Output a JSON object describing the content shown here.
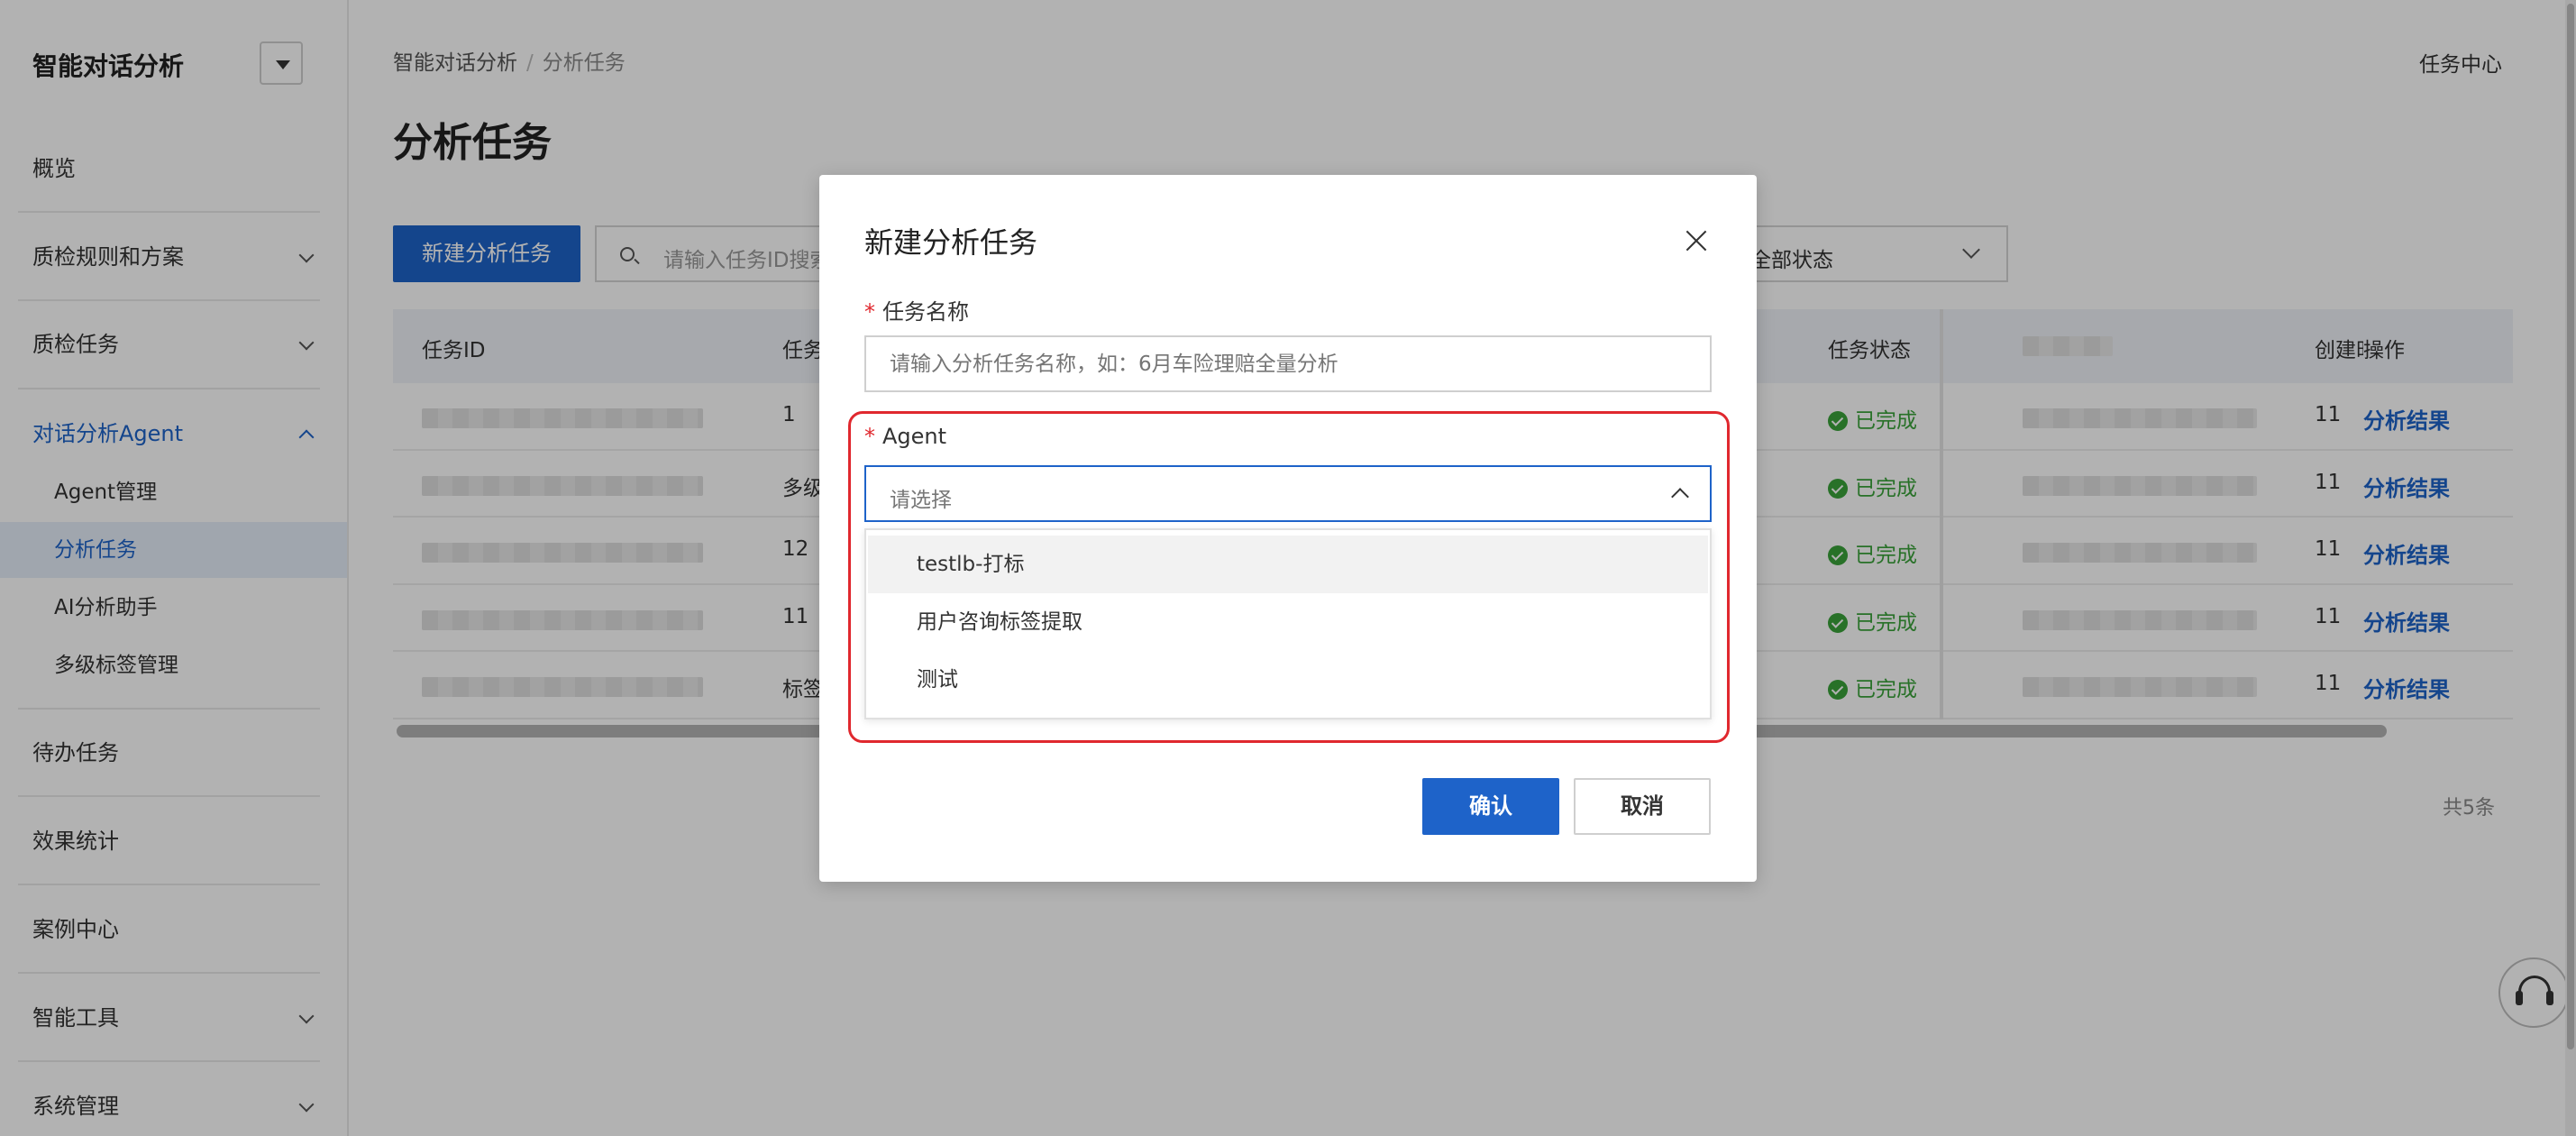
{
  "sidebar": {
    "brand": "智能对话分析",
    "items": [
      {
        "label": "概览"
      },
      {
        "label": "质检规则和方案"
      },
      {
        "label": "质检任务"
      },
      {
        "label": "对话分析Agent"
      },
      {
        "label": "待办任务"
      },
      {
        "label": "效果统计"
      },
      {
        "label": "案例中心"
      },
      {
        "label": "智能工具"
      },
      {
        "label": "系统管理"
      }
    ],
    "sub_items": [
      {
        "label": "Agent管理"
      },
      {
        "label": "分析任务"
      },
      {
        "label": "AI分析助手"
      },
      {
        "label": "多级标签管理"
      }
    ]
  },
  "header": {
    "breadcrumb": [
      "智能对话分析",
      "分析任务"
    ],
    "breadcrumb_sep": "/",
    "task_center": "任务中心",
    "title": "分析任务"
  },
  "toolbar": {
    "new_button": "新建分析任务",
    "search_placeholder": "请输入任务ID搜索",
    "status_filter": "全部状态"
  },
  "table": {
    "columns": {
      "id": "任务ID",
      "name": "任务名称",
      "status": "任务状态",
      "created": "创建时间",
      "ops": "操作"
    },
    "rows": [
      {
        "name": "1",
        "status": "已完成",
        "created": "11",
        "action": "分析结果"
      },
      {
        "name": "多级",
        "status": "已完成",
        "created": "11",
        "action": "分析结果"
      },
      {
        "name": "12",
        "status": "已完成",
        "created": "11",
        "action": "分析结果"
      },
      {
        "name": "11",
        "status": "已完成",
        "created": "11",
        "action": "分析结果"
      },
      {
        "name": "标签",
        "status": "已完成",
        "created": "11",
        "action": "分析结果"
      }
    ],
    "total": "共5条"
  },
  "modal": {
    "title": "新建分析任务",
    "required_mark": "*",
    "name_label": "任务名称",
    "name_placeholder": "请输入分析任务名称，如：6月车险理赔全量分析",
    "agent_label": "Agent",
    "agent_placeholder": "请选择",
    "agent_options": [
      "testlb-打标",
      "用户咨询标签提取",
      "测试"
    ],
    "confirm": "确认",
    "cancel": "取消"
  },
  "colors": {
    "primary": "#1e63c9",
    "success": "#3aa33a",
    "required": "#e0282e",
    "highlight_border": "#e0282e"
  }
}
